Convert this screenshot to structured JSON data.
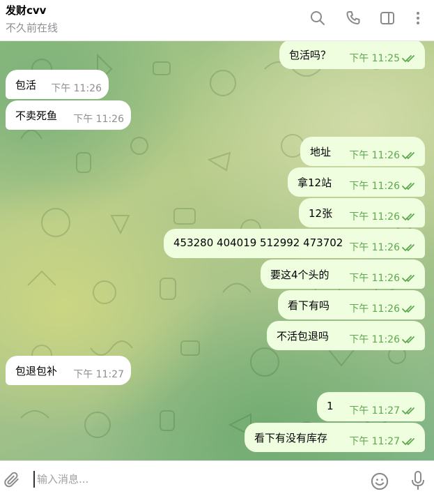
{
  "header": {
    "title": "发财cvv",
    "status": "不久前在线",
    "icons": [
      "search-icon",
      "phone-icon",
      "sidebar-icon",
      "more-vertical-icon"
    ]
  },
  "messages": [
    {
      "dir": "out",
      "text": "包活吗？",
      "time": "下午 11:25",
      "read": true
    },
    {
      "dir": "in",
      "text": "包活",
      "time": "下午 11:26"
    },
    {
      "dir": "in",
      "text": "不卖死鱼",
      "time": "下午 11:26"
    },
    {
      "dir": "out",
      "text": "地址",
      "time": "下午 11:26",
      "read": true
    },
    {
      "dir": "out",
      "text": "拿12站",
      "time": "下午 11:26",
      "read": true
    },
    {
      "dir": "out",
      "text": "12张",
      "time": "下午 11:26",
      "read": true
    },
    {
      "dir": "out",
      "text": "453280 404019 512992 473702",
      "time": "下午 11:26",
      "read": true
    },
    {
      "dir": "out",
      "text": "要这4个头的",
      "time": "下午 11:26",
      "read": true
    },
    {
      "dir": "out",
      "text": "看下有吗",
      "time": "下午 11:26",
      "read": true
    },
    {
      "dir": "out",
      "text": "不活包退吗",
      "time": "下午 11:26",
      "read": true
    },
    {
      "dir": "in",
      "text": "包退包补",
      "time": "下午 11:27"
    },
    {
      "dir": "out",
      "text": "1",
      "time": "下午 11:27",
      "read": true
    },
    {
      "dir": "out",
      "text": "看下有没有库存",
      "time": "下午 11:27",
      "read": true
    }
  ],
  "composer": {
    "placeholder": "输入消息...",
    "icons": [
      "paperclip-icon",
      "emoji-icon",
      "microphone-icon"
    ]
  },
  "colors": {
    "incoming_bubble": "#ffffff",
    "outgoing_bubble": "#eefedf",
    "read_check": "#5fa84f",
    "timestamp_in": "#8e8e93"
  }
}
